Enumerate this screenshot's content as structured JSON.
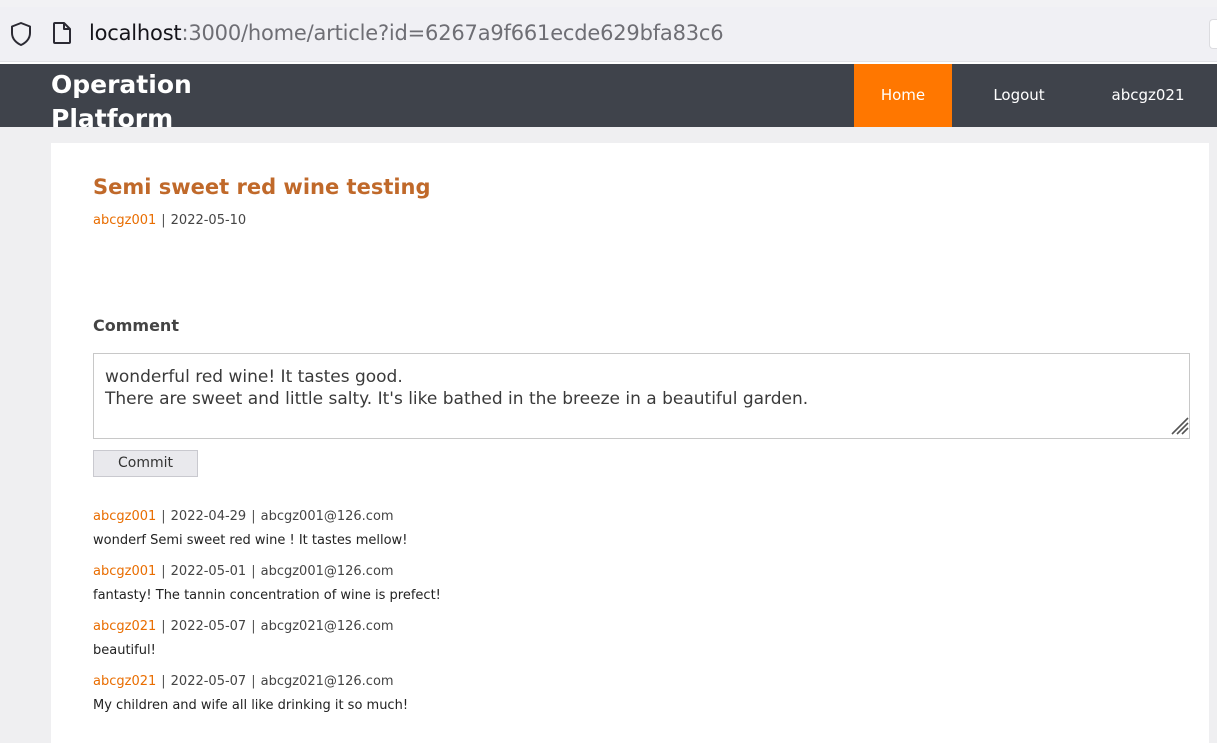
{
  "browser": {
    "url_host": "localhost",
    "url_path": ":3000/home/article?id=6267a9f661ecde629bfa83c6"
  },
  "navbar": {
    "brand": "Operation Platform",
    "items": [
      {
        "label": "Home",
        "active": true
      },
      {
        "label": "Logout",
        "active": false
      },
      {
        "label": "abcgz021",
        "active": false
      }
    ],
    "active_color": "#ff7700",
    "background": "#3f434b"
  },
  "article": {
    "title": "Semi sweet red wine testing",
    "author": "abcgz001",
    "separator": "|",
    "date": "2022-05-10"
  },
  "comment_form": {
    "heading": "Comment",
    "value": "wonderful red wine! It tastes good.\nThere are sweet and little salty. It's like bathed in the breeze in a beautiful garden.",
    "submit_label": "Commit"
  },
  "comments": [
    {
      "author": "abcgz001",
      "date": "2022-04-29",
      "email": "abcgz001@126.com",
      "text": "wonderf Semi sweet red wine ! It tastes mellow!"
    },
    {
      "author": "abcgz001",
      "date": "2022-05-01",
      "email": "abcgz001@126.com",
      "text": "fantasty! The tannin concentration of wine is prefect!"
    },
    {
      "author": "abcgz021",
      "date": "2022-05-07",
      "email": "abcgz021@126.com",
      "text": "beautiful!"
    },
    {
      "author": "abcgz021",
      "date": "2022-05-07",
      "email": "abcgz021@126.com",
      "text": "My children and wife all like drinking it so much!"
    }
  ],
  "colors": {
    "accent": "#ff7700",
    "title": "#c0692a",
    "author_link": "#e96d00"
  }
}
